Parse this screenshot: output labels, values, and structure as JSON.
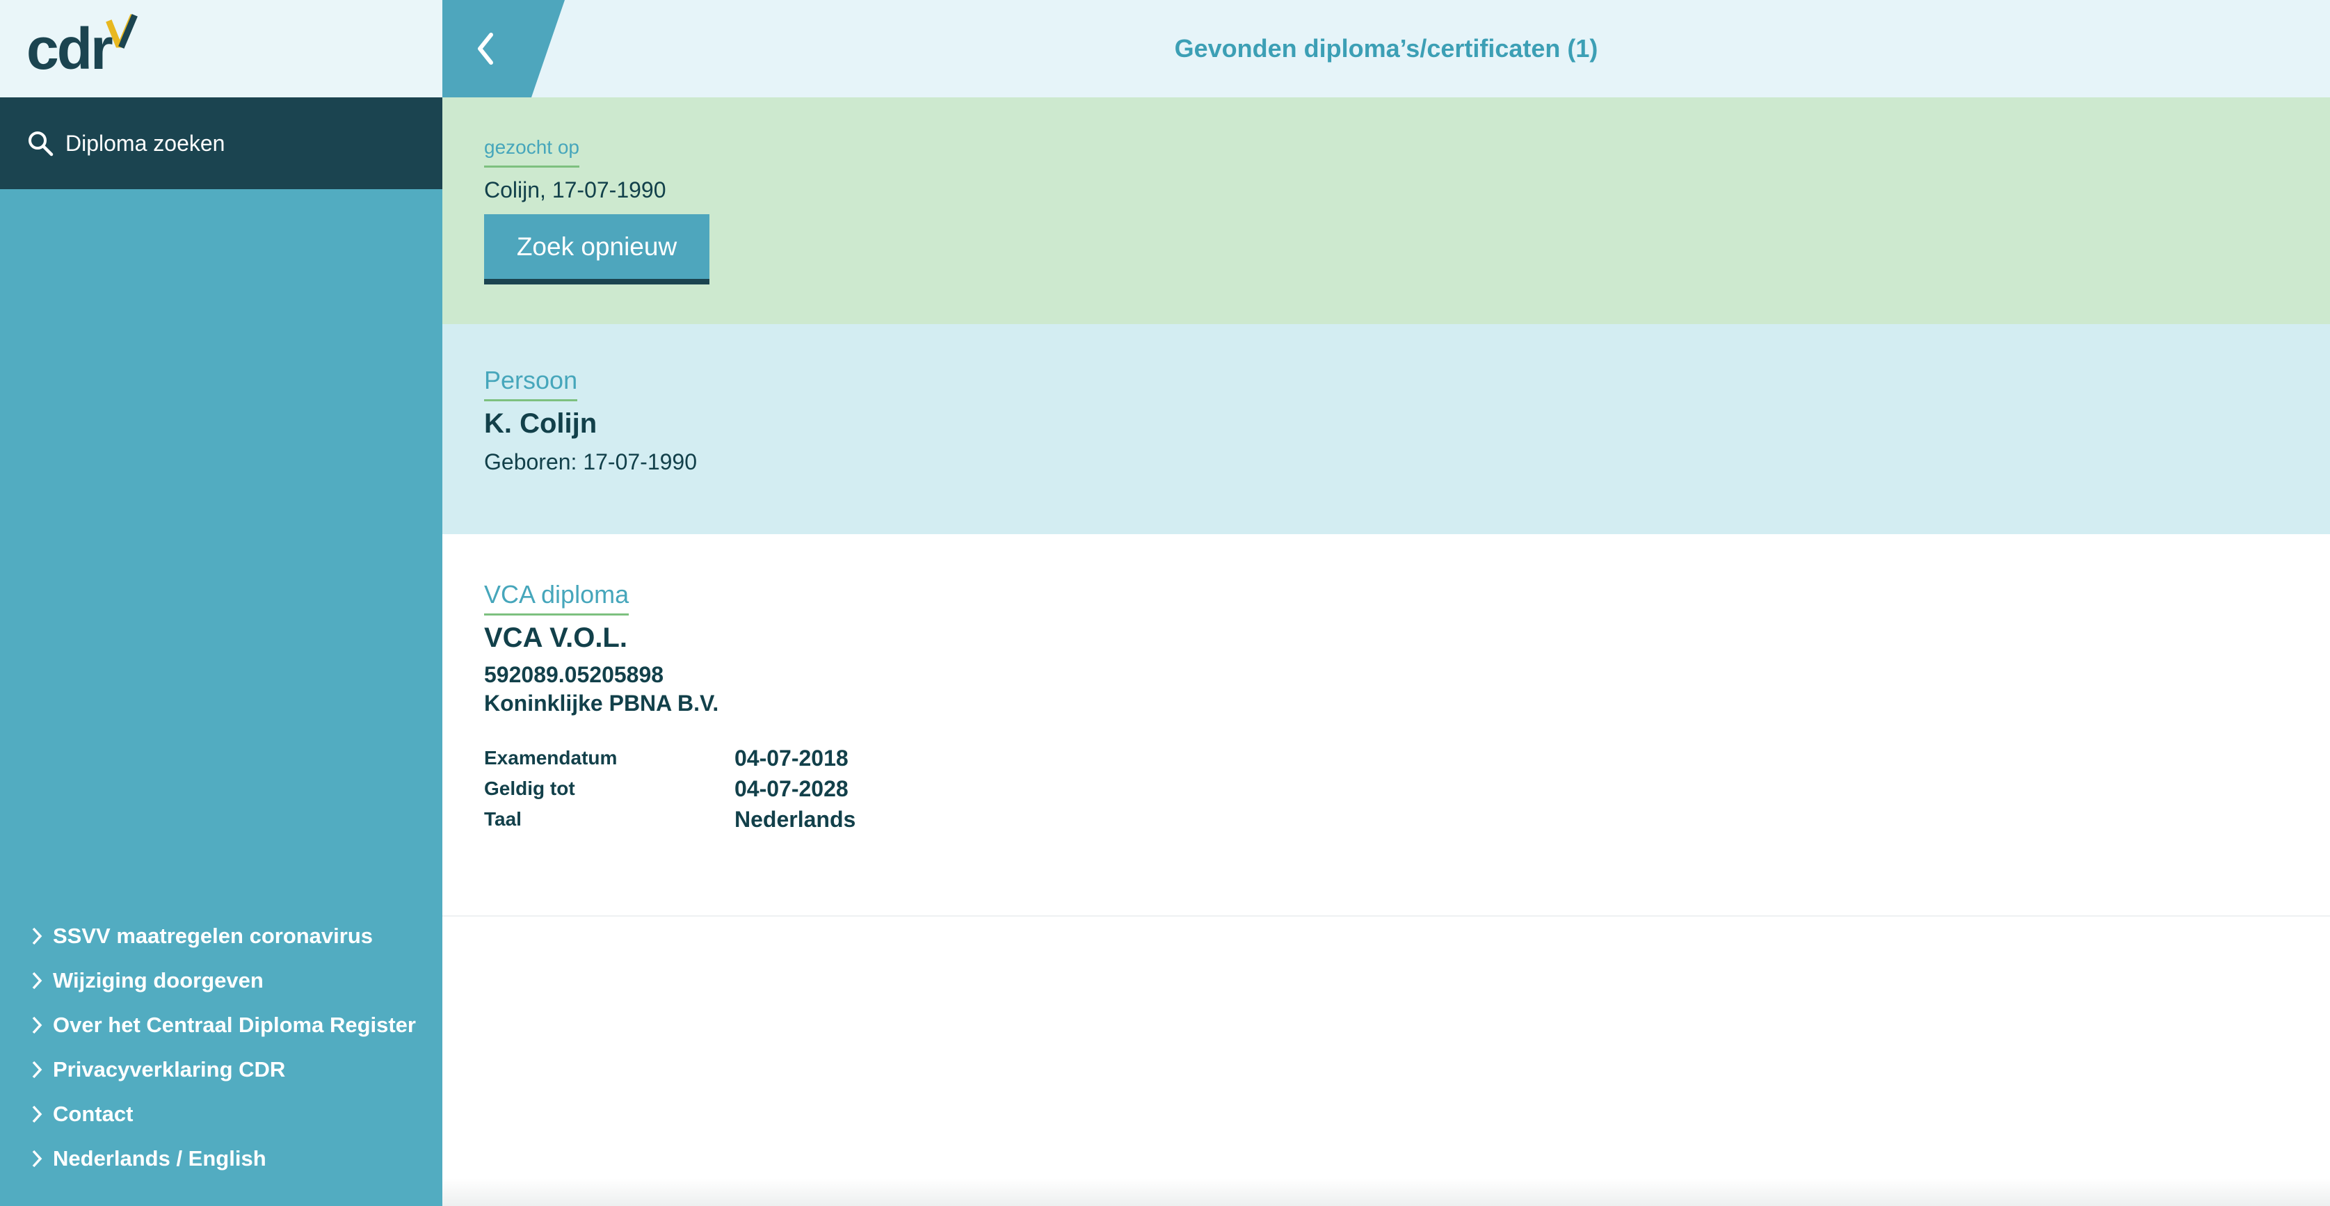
{
  "brand": {
    "logo_text": "cdr",
    "accent_color": "#52acc1",
    "dark_color": "#1b4450",
    "check_color": "#e8b820"
  },
  "sidebar": {
    "search_nav": {
      "label": "Diploma zoeken",
      "icon": "search-icon"
    },
    "footer_links": [
      {
        "label": "SSVV maatregelen coronavirus",
        "icon": "chevron-right-icon"
      },
      {
        "label": "Wijziging doorgeven",
        "icon": "chevron-right-icon"
      },
      {
        "label": "Over het Centraal Diploma Register",
        "icon": "chevron-right-icon"
      },
      {
        "label": "Privacyverklaring CDR",
        "icon": "chevron-right-icon"
      },
      {
        "label": "Contact",
        "icon": "chevron-right-icon"
      },
      {
        "label": "Nederlands / English",
        "icon": "chevron-right-icon"
      }
    ]
  },
  "header": {
    "back_icon": "chevron-left-icon",
    "title": "Gevonden diploma’s/certificaten (1)"
  },
  "search_summary": {
    "label": "gezocht op",
    "value": "Colijn, 17-07-1990",
    "button_label": "Zoek opnieuw"
  },
  "person": {
    "label": "Persoon",
    "name": "K. Colijn",
    "born": "Geboren: 17-07-1990"
  },
  "diploma": {
    "label": "VCA diploma",
    "name": "VCA V.O.L.",
    "number": "592089.05205898",
    "issuer": "Koninklijke PBNA B.V.",
    "details": [
      {
        "key": "Examendatum",
        "value": "04-07-2018"
      },
      {
        "key": "Geldig tot",
        "value": "04-07-2028"
      },
      {
        "key": "Taal",
        "value": "Nederlands"
      }
    ]
  }
}
